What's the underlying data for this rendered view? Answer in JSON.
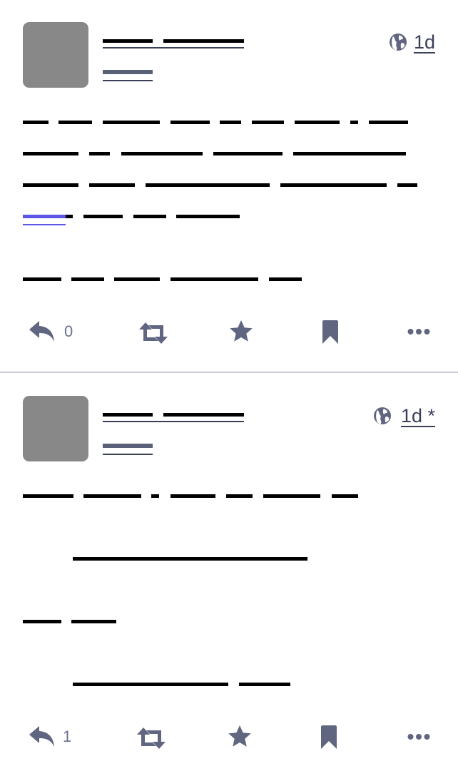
{
  "colors": {
    "action_icon": "#606580",
    "link": "#5c55e6",
    "avatar_placeholder": "#888888",
    "divider": "#c9ccd4",
    "timestamp": "#3a3f58"
  },
  "posts": [
    {
      "visibility_icon": "globe-icon",
      "timestamp": "1d",
      "actions": {
        "reply_count": "0",
        "icons": [
          "reply-icon",
          "boost-icon",
          "favourite-icon",
          "bookmark-icon",
          "more-icon"
        ]
      }
    },
    {
      "visibility_icon": "globe-icon",
      "timestamp": "1d *",
      "actions": {
        "reply_count": "1",
        "icons": [
          "reply-icon",
          "boost-icon",
          "favourite-icon",
          "bookmark-icon",
          "more-icon"
        ]
      }
    }
  ]
}
